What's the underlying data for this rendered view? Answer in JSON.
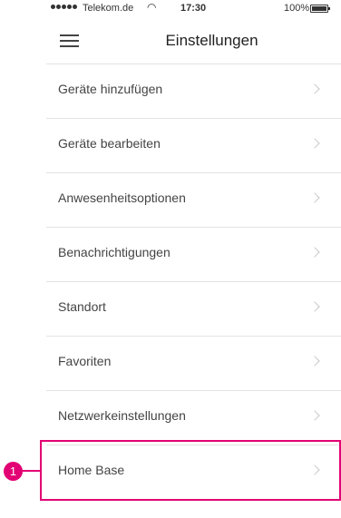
{
  "statusbar": {
    "carrier": "Telekom.de",
    "time": "17:30",
    "battery_percent": "100%"
  },
  "navbar": {
    "title": "Einstellungen",
    "menu_icon": "hamburger-menu-icon"
  },
  "settings": {
    "items": [
      {
        "label": "Geräte hinzufügen"
      },
      {
        "label": "Geräte bearbeiten"
      },
      {
        "label": "Anwesenheitsoptionen"
      },
      {
        "label": "Benachrichtigungen"
      },
      {
        "label": "Standort"
      },
      {
        "label": "Favoriten"
      },
      {
        "label": "Netzwerkeinstellungen"
      },
      {
        "label": "Home Base"
      }
    ]
  },
  "annotation": {
    "badge_number": "1",
    "color": "#e20074"
  }
}
